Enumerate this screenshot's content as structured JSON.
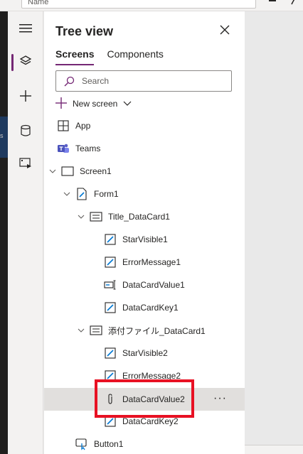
{
  "topbar": {
    "name_value": "Name"
  },
  "rail": {
    "items": [
      {
        "name": "hamburger-menu",
        "icon": "hamburger-icon"
      },
      {
        "name": "tree-view",
        "icon": "layers-icon",
        "active": true
      },
      {
        "name": "insert",
        "icon": "plus-icon"
      },
      {
        "name": "data",
        "icon": "database-icon"
      },
      {
        "name": "media",
        "icon": "media-icon"
      }
    ]
  },
  "left_edge": {
    "fragment": "s"
  },
  "panel": {
    "title": "Tree view",
    "tabs": [
      {
        "label": "Screens",
        "active": true
      },
      {
        "label": "Components",
        "active": false
      }
    ],
    "search": {
      "placeholder": "Search",
      "value": ""
    },
    "new_screen_label": "New screen"
  },
  "tree": [
    {
      "label": "App",
      "icon": "app-icon",
      "level": 0
    },
    {
      "label": "Teams",
      "icon": "teams-icon",
      "level": 0
    },
    {
      "label": "Screen1",
      "icon": "screen-icon",
      "level": 0,
      "expanded": true
    },
    {
      "label": "Form1",
      "icon": "form-icon",
      "level": 1,
      "expanded": true
    },
    {
      "label": "Title_DataCard1",
      "icon": "datacard-icon",
      "level": 2,
      "expanded": true
    },
    {
      "label": "StarVisible1",
      "icon": "label-icon",
      "level": 3
    },
    {
      "label": "ErrorMessage1",
      "icon": "label-icon",
      "level": 3
    },
    {
      "label": "DataCardValue1",
      "icon": "textinput-icon",
      "level": 3
    },
    {
      "label": "DataCardKey1",
      "icon": "label-icon",
      "level": 3
    },
    {
      "label": "添付ファイル_DataCard1",
      "icon": "datacard-icon",
      "level": 2,
      "expanded": true
    },
    {
      "label": "StarVisible2",
      "icon": "label-icon",
      "level": 3
    },
    {
      "label": "ErrorMessage2",
      "icon": "label-icon",
      "level": 3
    },
    {
      "label": "DataCardValue2",
      "icon": "attachment-icon",
      "level": 3,
      "selected": true,
      "more": "···"
    },
    {
      "label": "DataCardKey2",
      "icon": "label-icon",
      "level": 3
    },
    {
      "label": "Button1",
      "icon": "button-icon",
      "level": 1
    }
  ],
  "colors": {
    "accent": "#742774",
    "highlight": "#e81123",
    "selected_bg": "#e1dfdd"
  }
}
